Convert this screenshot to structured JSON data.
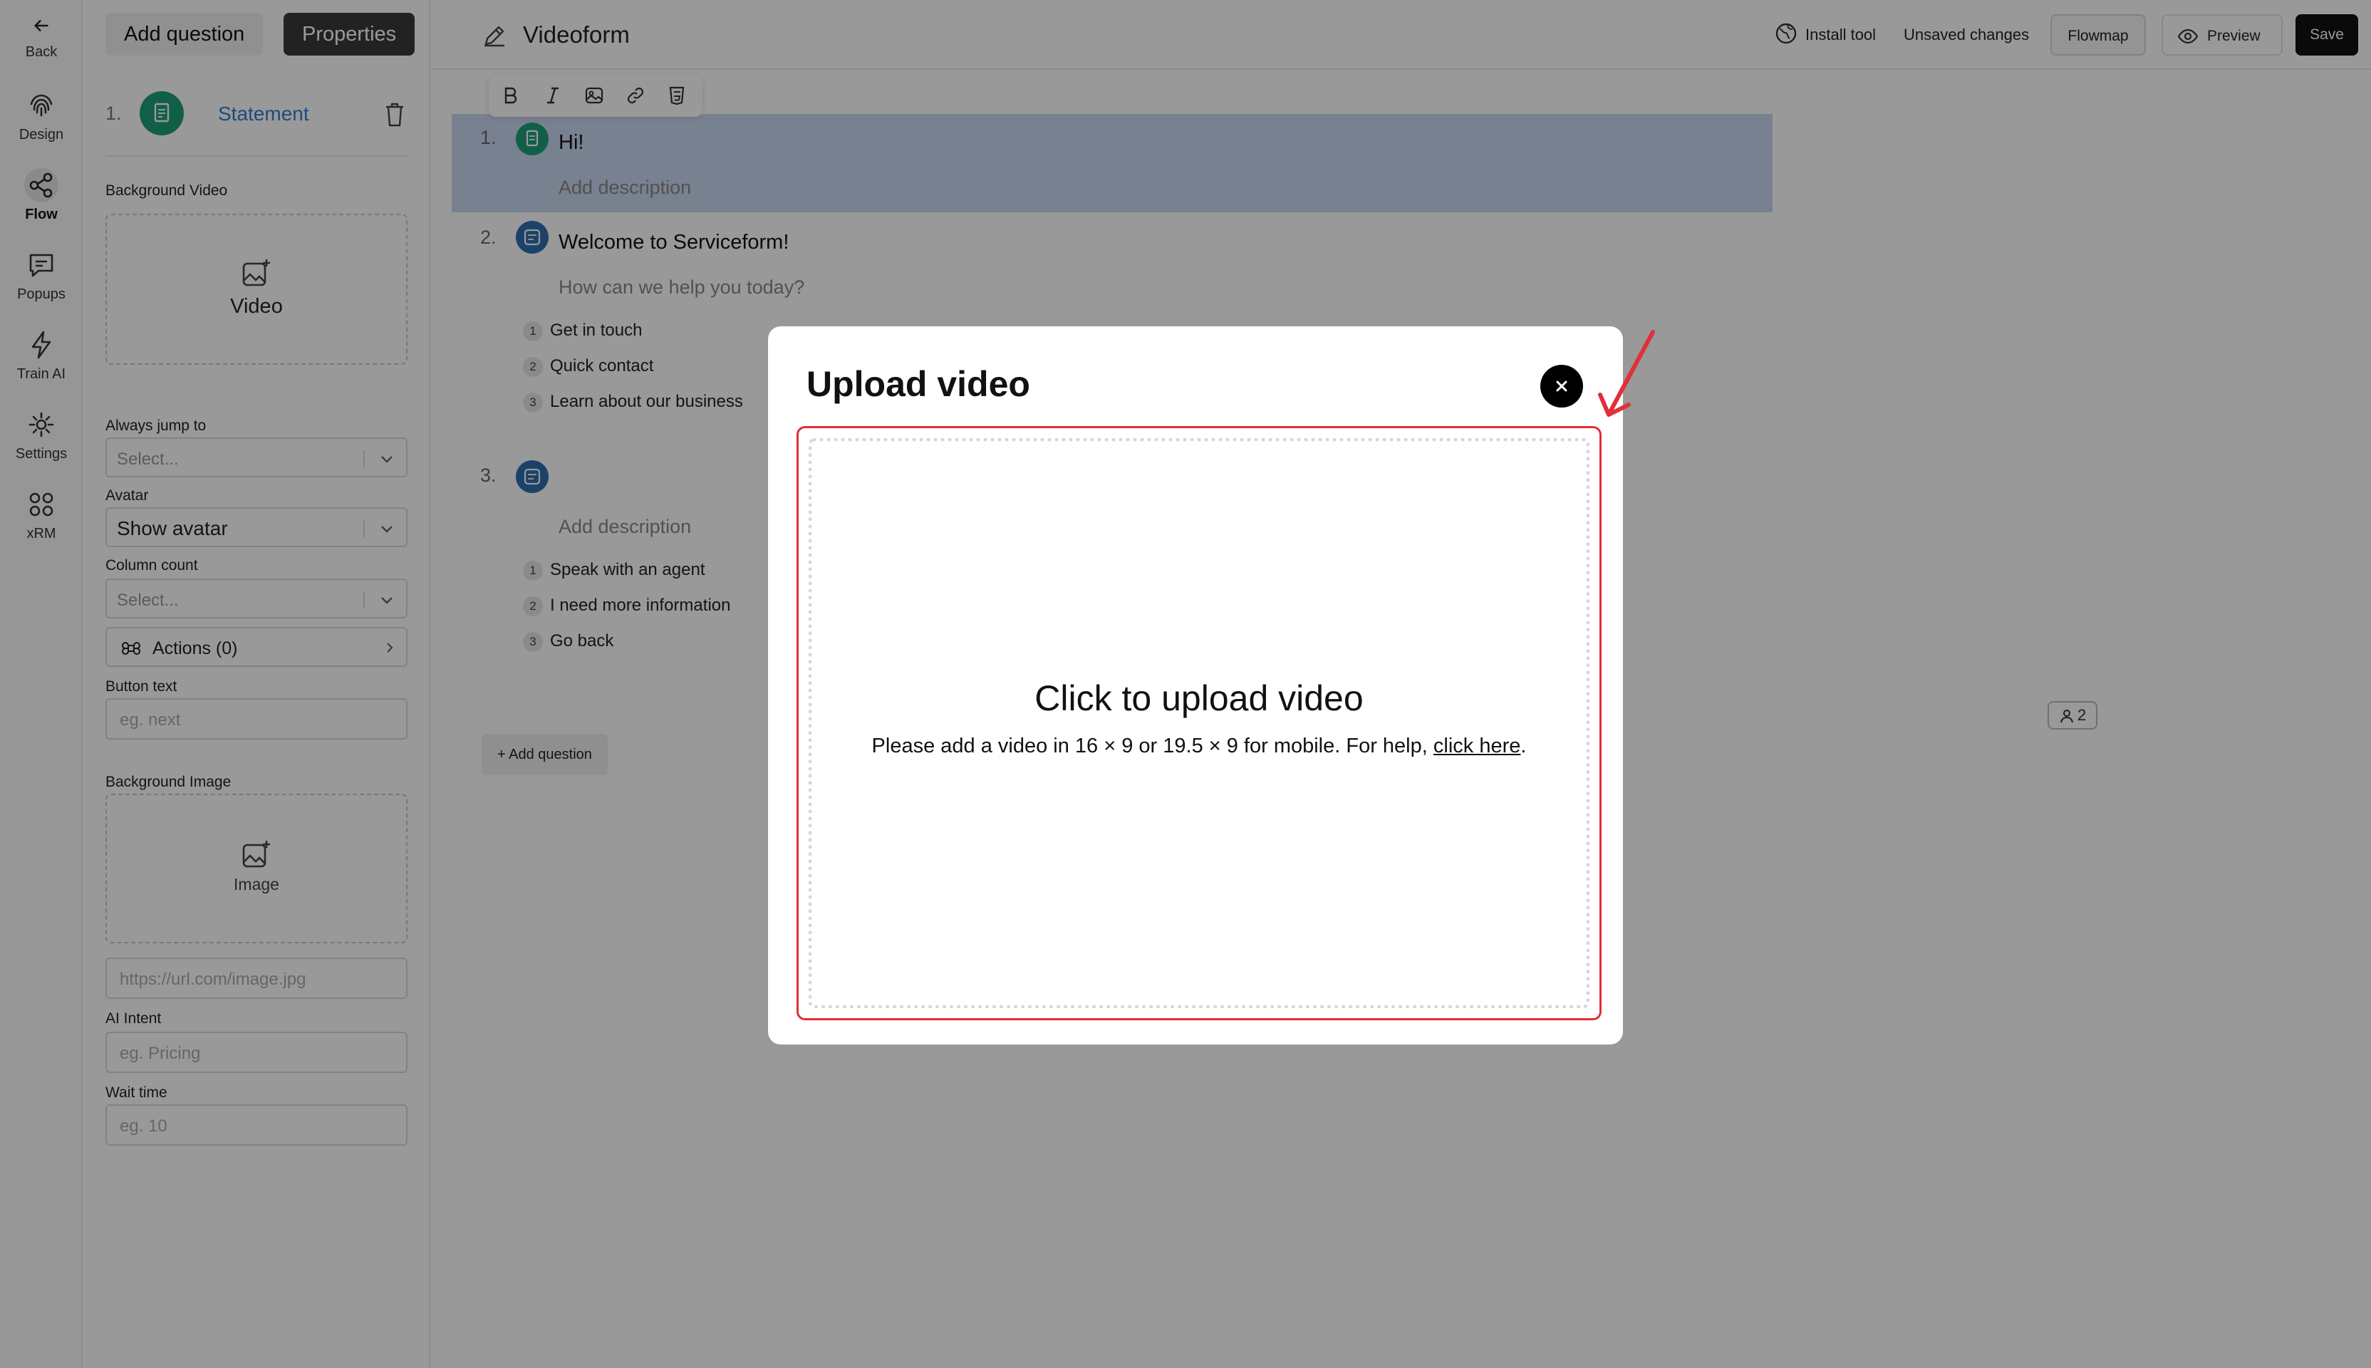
{
  "rail": {
    "back": "Back",
    "items": [
      {
        "label": "Design",
        "icon": "fingerprint-icon"
      },
      {
        "label": "Flow",
        "icon": "share-nodes-icon"
      },
      {
        "label": "Popups",
        "icon": "chat-bubble-icon"
      },
      {
        "label": "Train AI",
        "icon": "lightning-icon"
      },
      {
        "label": "Settings",
        "icon": "gear-icon"
      },
      {
        "label": "xRM",
        "icon": "grid-icon"
      }
    ]
  },
  "panel": {
    "tab_add": "Add question",
    "tab_properties": "Properties",
    "question_number": "1.",
    "question_type": "Statement",
    "background_video_label": "Background Video",
    "video_drop_label": "Video",
    "always_jump_label": "Always jump to",
    "always_jump_placeholder": "Select...",
    "avatar_label": "Avatar",
    "avatar_value": "Show avatar",
    "column_count_label": "Column count",
    "column_count_placeholder": "Select...",
    "actions_label": "Actions (0)",
    "button_text_label": "Button text",
    "button_text_placeholder": "eg. next",
    "background_image_label": "Background Image",
    "image_drop_label": "Image",
    "image_url_placeholder": "https://url.com/image.jpg",
    "ai_intent_label": "AI Intent",
    "ai_intent_placeholder": "eg. Pricing",
    "wait_time_label": "Wait time",
    "wait_time_placeholder": "eg. 10"
  },
  "topbar": {
    "title": "Videoform",
    "install_tool": "Install tool",
    "unsaved": "Unsaved changes",
    "flowmap": "Flowmap",
    "preview": "Preview",
    "save": "Save"
  },
  "flow": {
    "questions": [
      {
        "number": "1.",
        "title": "Hi!",
        "description": "Add description",
        "color": "#1f9e78",
        "options": []
      },
      {
        "number": "2.",
        "title": "Welcome to Serviceform!",
        "description": "How can we help you today?",
        "color": "#2f6fb0",
        "options": [
          {
            "n": "1",
            "label": "Get in touch"
          },
          {
            "n": "2",
            "label": "Quick contact"
          },
          {
            "n": "3",
            "label": "Learn about our business"
          }
        ]
      },
      {
        "number": "3.",
        "title": "",
        "description": "Add description",
        "color": "#2f6fb0",
        "options": [
          {
            "n": "1",
            "label": "Speak with an agent"
          },
          {
            "n": "2",
            "label": "I need more information"
          },
          {
            "n": "3",
            "label": "Go back"
          }
        ]
      }
    ],
    "add_question": "+ Add question",
    "badge_count": "2"
  },
  "modal": {
    "title": "Upload video",
    "heading": "Click to upload video",
    "subtext": "Please add a video in 16 × 9 or 19.5 × 9 for mobile. For help,",
    "link": "click here",
    "period": "."
  },
  "colors": {
    "accent_green": "#1f9e78",
    "accent_blue": "#2f6fb0",
    "highlight": "#c9d7f0",
    "dropzone_border": "#e0303a",
    "arrow": "#e0303a"
  }
}
